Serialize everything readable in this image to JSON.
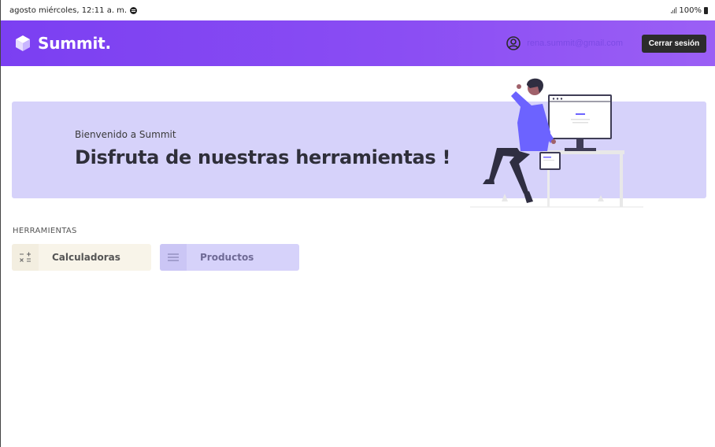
{
  "statusbar": {
    "datetime": "agosto miércoles, 12:11 a. m.",
    "battery": "100%"
  },
  "header": {
    "brand": "Summit.",
    "user_email": "rena.summit@gmail.com",
    "logout_label": "Cerrar sesión"
  },
  "banner": {
    "subtitle": "Bienvenido a Summit",
    "title": "Disfruta de nuestras herramientas !"
  },
  "tools": {
    "section_label": "HERRAMIENTAS",
    "items": [
      {
        "label": "Calculadoras",
        "icon": "calculator-icon"
      },
      {
        "label": "Productos",
        "icon": "list-icon"
      }
    ]
  },
  "colors": {
    "header_start": "#7b3ff2",
    "header_end": "#9b5ff5",
    "banner_bg": "#d6d2fa",
    "calc_bg": "#f8f4e9",
    "accent_figure": "#6c63ff"
  }
}
